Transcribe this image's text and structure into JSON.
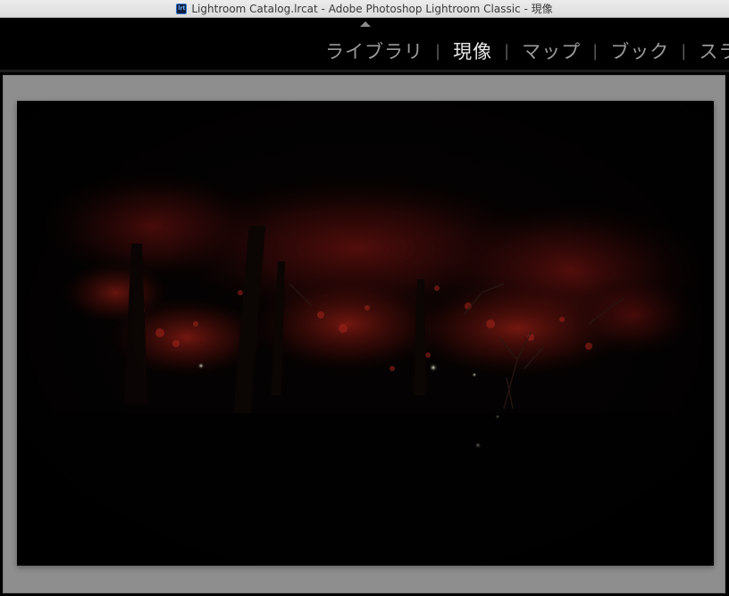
{
  "window": {
    "title": "Lightroom Catalog.lrcat - Adobe Photoshop Lightroom Classic - 現像",
    "app_icon_label": "lrt"
  },
  "module_picker": {
    "items": [
      {
        "label": "ライブラリ",
        "active": false
      },
      {
        "label": "現像",
        "active": true
      },
      {
        "label": "マップ",
        "active": false
      },
      {
        "label": "ブック",
        "active": false
      },
      {
        "label": "スライ",
        "active": false
      }
    ],
    "separator": "|"
  },
  "colors": {
    "canvas_gray": "#8e8e8e",
    "active_module": "#e6e6e6",
    "inactive_module": "#9a9a9a",
    "foliage_red": "#7a1410"
  },
  "photo": {
    "subject": "night-illuminated red autumn trees"
  }
}
